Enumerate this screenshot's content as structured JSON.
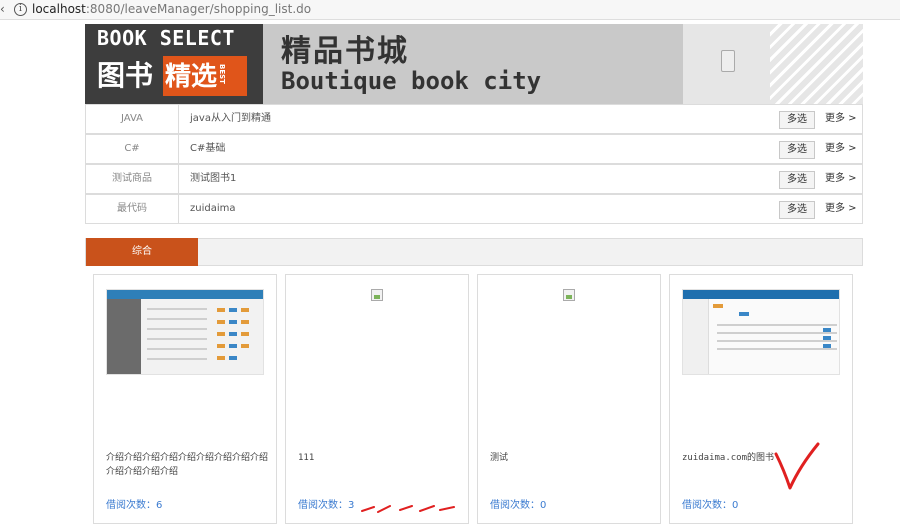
{
  "browser": {
    "left_glyph": "‹",
    "info_icon": "i",
    "url_host": "localhost",
    "url_path": ":8080/leaveManager/shopping_list.do"
  },
  "banner": {
    "logo_en": "BOOK SELECT",
    "logo_cn_main": "图书",
    "logo_cn_highlight": "精选",
    "logo_best": "BEST",
    "title_cn": "精品书城",
    "title_en": "Boutique book city"
  },
  "categories": [
    {
      "name": "JAVA",
      "item": "java从入门到精通",
      "multi": "多选",
      "more": "更多 >"
    },
    {
      "name": "C#",
      "item": "C#基础",
      "multi": "多选",
      "more": "更多 >"
    },
    {
      "name": "测试商品",
      "item": "测试图书1",
      "multi": "多选",
      "more": "更多 >"
    },
    {
      "name": "最代码",
      "item": "zuidaima",
      "multi": "多选",
      "more": "更多 >"
    }
  ],
  "tabs": {
    "active": "综合"
  },
  "books": [
    {
      "desc": "介绍介绍介绍介绍介绍介绍介绍介绍介绍介绍介绍介绍介绍",
      "count": "借阅次数：6",
      "image": "screenshot-thumb"
    },
    {
      "desc": "111",
      "count": "借阅次数：3",
      "image": "broken-image-icon"
    },
    {
      "desc": "测试",
      "count": "借阅次数：0",
      "image": "broken-image-icon"
    },
    {
      "desc": "zuidaima.com的图书",
      "count": "借阅次数：0",
      "image": "screenshot-thumb"
    }
  ],
  "colors": {
    "accent": "#c9521b",
    "link": "#3b7bd0",
    "annotation": "#e02020"
  }
}
